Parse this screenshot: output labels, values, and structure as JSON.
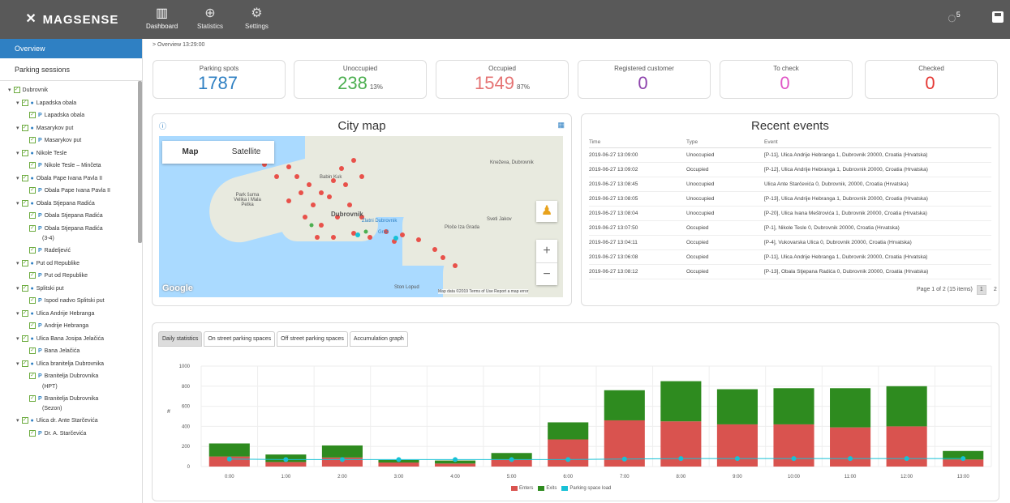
{
  "app": {
    "name": "MAGSENSE"
  },
  "nav": [
    {
      "label": "Dashboard",
      "icon": "dashboard-icon"
    },
    {
      "label": "Statistics",
      "icon": "statistics-icon"
    },
    {
      "label": "Settings",
      "icon": "settings-icon"
    }
  ],
  "notifications": {
    "count": "5"
  },
  "sidebar": {
    "overview": "Overview",
    "sessions": "Parking sessions",
    "tree": [
      {
        "level": 0,
        "label": "Dubrovnik"
      },
      {
        "level": 1,
        "label": "Lapadska obala"
      },
      {
        "level": 2,
        "label": "Lapadska obala"
      },
      {
        "level": 1,
        "label": "Masarykov put"
      },
      {
        "level": 2,
        "label": "Masarykov put"
      },
      {
        "level": 1,
        "label": "Nikole Tesle"
      },
      {
        "level": 2,
        "label": "Nikole Tesle – Minčeta"
      },
      {
        "level": 1,
        "label": "Obala Pape Ivana Pavla II"
      },
      {
        "level": 2,
        "label": "Obala Pape Ivana Pavla II"
      },
      {
        "level": 1,
        "label": "Obala Stjepana Radića"
      },
      {
        "level": 2,
        "label": "Obala Stjepana Radića"
      },
      {
        "level": 2,
        "label": "Obala Stjepana Radića"
      },
      {
        "level": 3,
        "label": "(3-4)"
      },
      {
        "level": 2,
        "label": "Radeljević"
      },
      {
        "level": 1,
        "label": "Put od Republike"
      },
      {
        "level": 2,
        "label": "Put od Republike"
      },
      {
        "level": 1,
        "label": "Splitski put"
      },
      {
        "level": 2,
        "label": "Ispod nadvo Splitski put"
      },
      {
        "level": 1,
        "label": "Ulica Andrije Hebranga"
      },
      {
        "level": 2,
        "label": "Andrije Hebranga"
      },
      {
        "level": 1,
        "label": "Ulica Bana Josipa Jelačića"
      },
      {
        "level": 2,
        "label": "Bana Jelačića"
      },
      {
        "level": 1,
        "label": "Ulica branitelja Dubrovnika"
      },
      {
        "level": 2,
        "label": "Branitelja Dubrovnika"
      },
      {
        "level": 3,
        "label": "(HPT)"
      },
      {
        "level": 2,
        "label": "Branitelja Dubrovnika"
      },
      {
        "level": 3,
        "label": "(Sezon)"
      },
      {
        "level": 1,
        "label": "Ulica dr. Ante Starčevića"
      },
      {
        "level": 2,
        "label": "Dr. A. Starčevića"
      }
    ]
  },
  "breadcrumb": "> Overview  13:29:00",
  "stats": [
    {
      "label": "Parking spots",
      "value": "1787",
      "pct": "",
      "color": "#2f80c3"
    },
    {
      "label": "Unoccupied",
      "value": "238",
      "pct": "13%",
      "color": "#4caf50"
    },
    {
      "label": "Occupied",
      "value": "1549",
      "pct": "87%",
      "color": "#e57373"
    },
    {
      "label": "Registered customer",
      "value": "0",
      "pct": "",
      "color": "#8e44ad"
    },
    {
      "label": "To check",
      "value": "0",
      "pct": "",
      "color": "#e056c6"
    },
    {
      "label": "Checked",
      "value": "0",
      "pct": "",
      "color": "#e53935"
    }
  ],
  "city_map": {
    "title": "City map",
    "tab_map": "Map",
    "tab_satellite": "Satellite",
    "google": "Google",
    "attribution": "Map data ©2019  Terms of Use  Report a map error",
    "labels": [
      "Dubrovnik",
      "Babin Kuk",
      "Kneževa, Dubrovnik",
      "Park šuma Velika i Mala Petka",
      "Gruž",
      "Zlatni Dubrovnik",
      "Sveti Jakov",
      "Ploče Iza Grada",
      "Ston Lopud"
    ]
  },
  "events": {
    "title": "Recent events",
    "columns": [
      "Time",
      "Type",
      "Event"
    ],
    "rows": [
      [
        "2019-06-27 13:09:00",
        "Unoccupied",
        "[P-11], Ulica Andrije Hebranga 1, Dubrovnik 20000, Croatia (Hrvatska)"
      ],
      [
        "2019-06-27 13:09:02",
        "Occupied",
        "[P-12], Ulica Andrije Hebranga 1, Dubrovnik 20000, Croatia (Hrvatska)"
      ],
      [
        "2019-06-27 13:08:45",
        "Unoccupied",
        "Ulica Ante Starčevića 0, Dubrovnik, 20000, Croatia (Hrvatska)"
      ],
      [
        "2019-06-27 13:08:05",
        "Unoccupied",
        "[P-13], Ulica Andrije Hebranga 1, Dubrovnik 20000, Croatia (Hrvatska)"
      ],
      [
        "2019-06-27 13:08:04",
        "Unoccupied",
        "[P-20], Ulica Ivana Meštrovića 1, Dubrovnik 20000, Croatia (Hrvatska)"
      ],
      [
        "2019-06-27 13:07:50",
        "Occupied",
        "[P-1], Nikole Tesle 0, Dubrovnik 20000, Croatia (Hrvatska)"
      ],
      [
        "2019-06-27 13:04:11",
        "Occupied",
        "[P-4], Vukovarska Ulica 0, Dubrovnik 20000, Croatia (Hrvatska)"
      ],
      [
        "2019-06-27 13:06:08",
        "Occupied",
        "[P-11], Ulica Andrije Hebranga 1, Dubrovnik 20000, Croatia (Hrvatska)"
      ],
      [
        "2019-06-27 13:08:12",
        "Occupied",
        "[P-13], Obala Stjepana Radića 0, Dubrovnik 20000, Croatia (Hrvatska)"
      ]
    ],
    "pager_text": "Page 1 of 2 (15 items)",
    "pages": [
      "1",
      "2"
    ]
  },
  "tabs": [
    "Daily statistics",
    "On street parking spaces",
    "Off street parking spaces",
    "Accumulation graph"
  ],
  "chart_data": {
    "type": "bar",
    "categories": [
      "0:00",
      "1:00",
      "2:00",
      "3:00",
      "4:00",
      "5:00",
      "6:00",
      "7:00",
      "8:00",
      "9:00",
      "10:00",
      "11:00",
      "12:00",
      "13:00"
    ],
    "series": [
      {
        "name": "Enters",
        "values": [
          100,
          45,
          90,
          40,
          30,
          70,
          270,
          460,
          450,
          420,
          420,
          390,
          400,
          70
        ],
        "color": "#d9534f"
      },
      {
        "name": "Exits",
        "values": [
          130,
          75,
          120,
          25,
          30,
          65,
          170,
          300,
          400,
          350,
          360,
          390,
          400,
          85
        ],
        "color": "#2e8b1f"
      },
      {
        "name": "Parking space load",
        "values": [
          75,
          70,
          70,
          70,
          70,
          70,
          70,
          75,
          80,
          80,
          80,
          80,
          80,
          80
        ],
        "color": "#17c1d6"
      }
    ],
    "ylim": [
      0,
      1000
    ],
    "yticks": [
      "0",
      "200",
      "400",
      "600",
      "800",
      "1000"
    ],
    "ylabel": "#",
    "stacked": true,
    "grid": true,
    "legend": "bottom"
  }
}
